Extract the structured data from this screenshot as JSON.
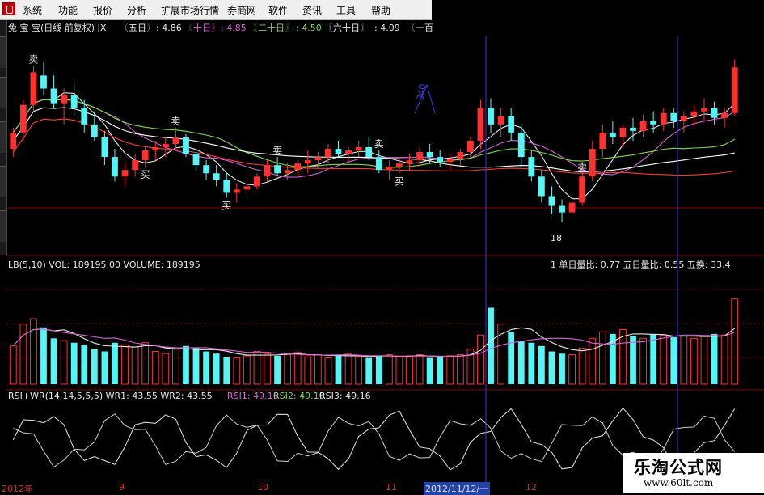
{
  "app": {
    "menu": [
      "系统",
      "功能",
      "报价",
      "分析",
      "扩展市场行情",
      "券商网",
      "软件",
      "资讯",
      "工具",
      "帮助"
    ]
  },
  "price_panel": {
    "title": "兔 宝 宝(日线 前复权) JX",
    "ma5_label": "〖五日〗",
    "ma5_value": ": 4.86",
    "ma10_label": "〖十日〗",
    "ma10_value": ": 4.85",
    "ma20_label": "〖二十日〗",
    "ma20_value": ": 4.50",
    "ma60_label": "〖六十日〗",
    "ma60_value": ": 4.09",
    "ma_more_label": "〖一百",
    "annotation_sell": "卖",
    "annotation_buy": "买",
    "low_marker": "18",
    "arrow_text": "340"
  },
  "volume_panel": {
    "header_left": "LB(5,10)  VOL: 189195.00   VOLUME: 189195",
    "header_right": "1 单日量比: 0.77  五日量比: 0.55  五换: 33.4"
  },
  "rsi_panel": {
    "header_prefix": "RSI+WR(14,14,5,5,5)  WR1: 43.55  WR2: 43.55",
    "rsi1": "RSI1: 49.16",
    "rsi2": "RSI2: 49.16",
    "rsi3": "RSI3: 49.16"
  },
  "date_axis": [
    "2012年",
    "9",
    "10",
    "11",
    "2012/11/12/一",
    "12"
  ],
  "watermark": {
    "title": "乐淘公式网",
    "url": "www.60lt.com"
  },
  "colors": {
    "up": "#ff3030",
    "down": "#54f5f5",
    "doji": "#ffffff",
    "ma5": "#e8e8e8",
    "ma10": "#d466d4",
    "ma20": "#7ddc4a",
    "ma60": "#ffffff",
    "ma100": "#ff3a3a",
    "grid": "#8b0000",
    "cursor": "#3a3ae0"
  },
  "chart_data": {
    "type": "candlestick",
    "candles": [
      [
        4.05,
        4.18,
        4.0,
        4.15
      ],
      [
        4.15,
        4.35,
        4.1,
        4.32
      ],
      [
        4.32,
        4.56,
        4.28,
        4.52
      ],
      [
        4.5,
        4.58,
        4.38,
        4.42
      ],
      [
        4.42,
        4.5,
        4.3,
        4.33
      ],
      [
        4.33,
        4.42,
        4.2,
        4.38
      ],
      [
        4.38,
        4.45,
        4.25,
        4.3
      ],
      [
        4.3,
        4.35,
        4.15,
        4.2
      ],
      [
        4.2,
        4.28,
        4.1,
        4.12
      ],
      [
        4.12,
        4.16,
        3.95,
        4.0
      ],
      [
        4.0,
        4.05,
        3.85,
        3.88
      ],
      [
        3.88,
        3.96,
        3.82,
        3.92
      ],
      [
        3.92,
        4.02,
        3.88,
        3.98
      ],
      [
        3.98,
        4.06,
        3.94,
        4.04
      ],
      [
        4.04,
        4.1,
        3.98,
        4.06
      ],
      [
        4.06,
        4.12,
        4.0,
        4.08
      ],
      [
        4.08,
        4.18,
        4.05,
        4.12
      ],
      [
        4.12,
        4.14,
        4.0,
        4.02
      ],
      [
        4.02,
        4.04,
        3.92,
        3.95
      ],
      [
        3.95,
        3.98,
        3.86,
        3.9
      ],
      [
        3.9,
        3.95,
        3.82,
        3.86
      ],
      [
        3.86,
        3.9,
        3.75,
        3.78
      ],
      [
        3.78,
        3.84,
        3.72,
        3.8
      ],
      [
        3.8,
        3.86,
        3.76,
        3.82
      ],
      [
        3.82,
        3.9,
        3.8,
        3.88
      ],
      [
        3.88,
        3.98,
        3.85,
        3.95
      ],
      [
        3.95,
        4.0,
        3.88,
        3.9
      ],
      [
        3.9,
        3.96,
        3.86,
        3.92
      ],
      [
        3.92,
        3.98,
        3.88,
        3.96
      ],
      [
        3.96,
        4.04,
        3.9,
        3.98
      ],
      [
        3.98,
        4.03,
        3.93,
        4.0
      ],
      [
        4.0,
        4.08,
        3.96,
        4.05
      ],
      [
        4.05,
        4.1,
        4.0,
        4.02
      ],
      [
        4.02,
        4.06,
        3.96,
        4.04
      ],
      [
        4.04,
        4.1,
        4.0,
        4.06
      ],
      [
        4.06,
        4.12,
        3.98,
        4.0
      ],
      [
        4.0,
        4.04,
        3.9,
        3.92
      ],
      [
        3.92,
        3.98,
        3.86,
        3.94
      ],
      [
        3.94,
        4.0,
        3.9,
        3.96
      ],
      [
        3.96,
        4.02,
        3.92,
        3.98
      ],
      [
        3.98,
        4.06,
        3.94,
        4.03
      ],
      [
        4.03,
        4.08,
        3.96,
        4.0
      ],
      [
        4.0,
        4.04,
        3.94,
        3.97
      ],
      [
        3.97,
        4.02,
        3.92,
        3.99
      ],
      [
        3.99,
        4.05,
        3.95,
        4.03
      ],
      [
        4.03,
        4.12,
        4.0,
        4.1
      ],
      [
        4.1,
        4.35,
        4.05,
        4.3
      ],
      [
        4.3,
        4.36,
        4.15,
        4.2
      ],
      [
        4.2,
        4.3,
        4.12,
        4.25
      ],
      [
        4.25,
        4.3,
        4.1,
        4.15
      ],
      [
        4.15,
        4.2,
        3.95,
        4.0
      ],
      [
        4.0,
        4.04,
        3.85,
        3.88
      ],
      [
        3.88,
        3.92,
        3.72,
        3.76
      ],
      [
        3.76,
        3.82,
        3.65,
        3.7
      ],
      [
        3.7,
        3.74,
        3.6,
        3.66
      ],
      [
        3.66,
        3.76,
        3.63,
        3.72
      ],
      [
        3.72,
        3.9,
        3.7,
        3.88
      ],
      [
        3.88,
        4.1,
        3.85,
        4.05
      ],
      [
        4.05,
        4.2,
        4.0,
        4.15
      ],
      [
        4.15,
        4.22,
        4.08,
        4.12
      ],
      [
        4.12,
        4.2,
        4.06,
        4.18
      ],
      [
        4.18,
        4.24,
        4.1,
        4.16
      ],
      [
        4.16,
        4.26,
        4.12,
        4.22
      ],
      [
        4.22,
        4.28,
        4.15,
        4.2
      ],
      [
        4.2,
        4.3,
        4.16,
        4.27
      ],
      [
        4.27,
        4.3,
        4.18,
        4.22
      ],
      [
        4.22,
        4.28,
        4.15,
        4.25
      ],
      [
        4.25,
        4.32,
        4.2,
        4.28
      ],
      [
        4.28,
        4.36,
        4.22,
        4.3
      ],
      [
        4.3,
        4.34,
        4.2,
        4.24
      ],
      [
        4.24,
        4.3,
        4.18,
        4.27
      ],
      [
        4.27,
        4.6,
        4.25,
        4.55
      ]
    ],
    "volumes": [
      0.35,
      0.55,
      0.6,
      0.52,
      0.42,
      0.4,
      0.38,
      0.36,
      0.32,
      0.3,
      0.38,
      0.36,
      0.34,
      0.38,
      0.3,
      0.28,
      0.32,
      0.35,
      0.33,
      0.3,
      0.28,
      0.25,
      0.24,
      0.26,
      0.3,
      0.28,
      0.26,
      0.27,
      0.29,
      0.25,
      0.27,
      0.24,
      0.26,
      0.28,
      0.25,
      0.24,
      0.26,
      0.27,
      0.25,
      0.26,
      0.27,
      0.24,
      0.25,
      0.26,
      0.27,
      0.32,
      0.45,
      0.7,
      0.55,
      0.48,
      0.4,
      0.38,
      0.35,
      0.3,
      0.28,
      0.27,
      0.33,
      0.42,
      0.48,
      0.46,
      0.5,
      0.44,
      0.42,
      0.46,
      0.45,
      0.43,
      0.44,
      0.42,
      0.44,
      0.46,
      0.45,
      0.78
    ],
    "price_ylim": [
      3.4,
      4.75
    ],
    "volume_ylim": [
      0,
      1.0
    ],
    "rsi_ylim": [
      0,
      100
    ]
  }
}
